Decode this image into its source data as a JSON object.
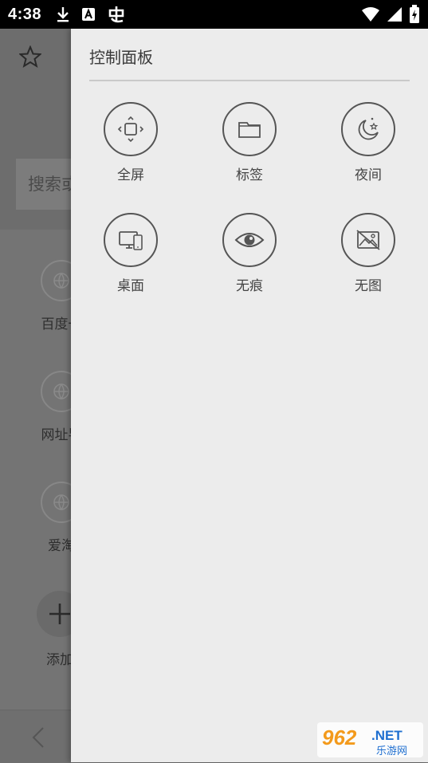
{
  "status_bar": {
    "time": "4:38",
    "notification_icons": [
      "download-icon",
      "font-app-icon",
      "app-glyph-icon"
    ],
    "system_icons": [
      "wifi-icon",
      "signal-icon",
      "battery-charging-icon"
    ]
  },
  "background_page": {
    "search_placeholder": "搜索或",
    "shortcuts": [
      {
        "label": "百度一",
        "icon": "globe-icon"
      },
      {
        "label": "网址导",
        "icon": "globe-icon"
      },
      {
        "label": "爱淘",
        "icon": "globe-icon"
      },
      {
        "label": "添加",
        "icon": "plus-icon"
      }
    ]
  },
  "drawer": {
    "title": "控制面板",
    "tools": [
      {
        "label": "全屏",
        "icon": "fullscreen-icon"
      },
      {
        "label": "标签",
        "icon": "tabs-folder-icon"
      },
      {
        "label": "夜间",
        "icon": "night-moon-icon"
      },
      {
        "label": "桌面",
        "icon": "desktop-mode-icon"
      },
      {
        "label": "无痕",
        "icon": "incognito-eye-icon"
      },
      {
        "label": "无图",
        "icon": "no-image-icon"
      }
    ]
  },
  "watermark": {
    "brand": "962.NET",
    "tagline": "乐游网"
  },
  "colors": {
    "drawer_bg": "#ececec",
    "dim_overlay": "#747474",
    "watermark_orange": "#f39a1c",
    "watermark_blue": "#1f6fd0"
  }
}
